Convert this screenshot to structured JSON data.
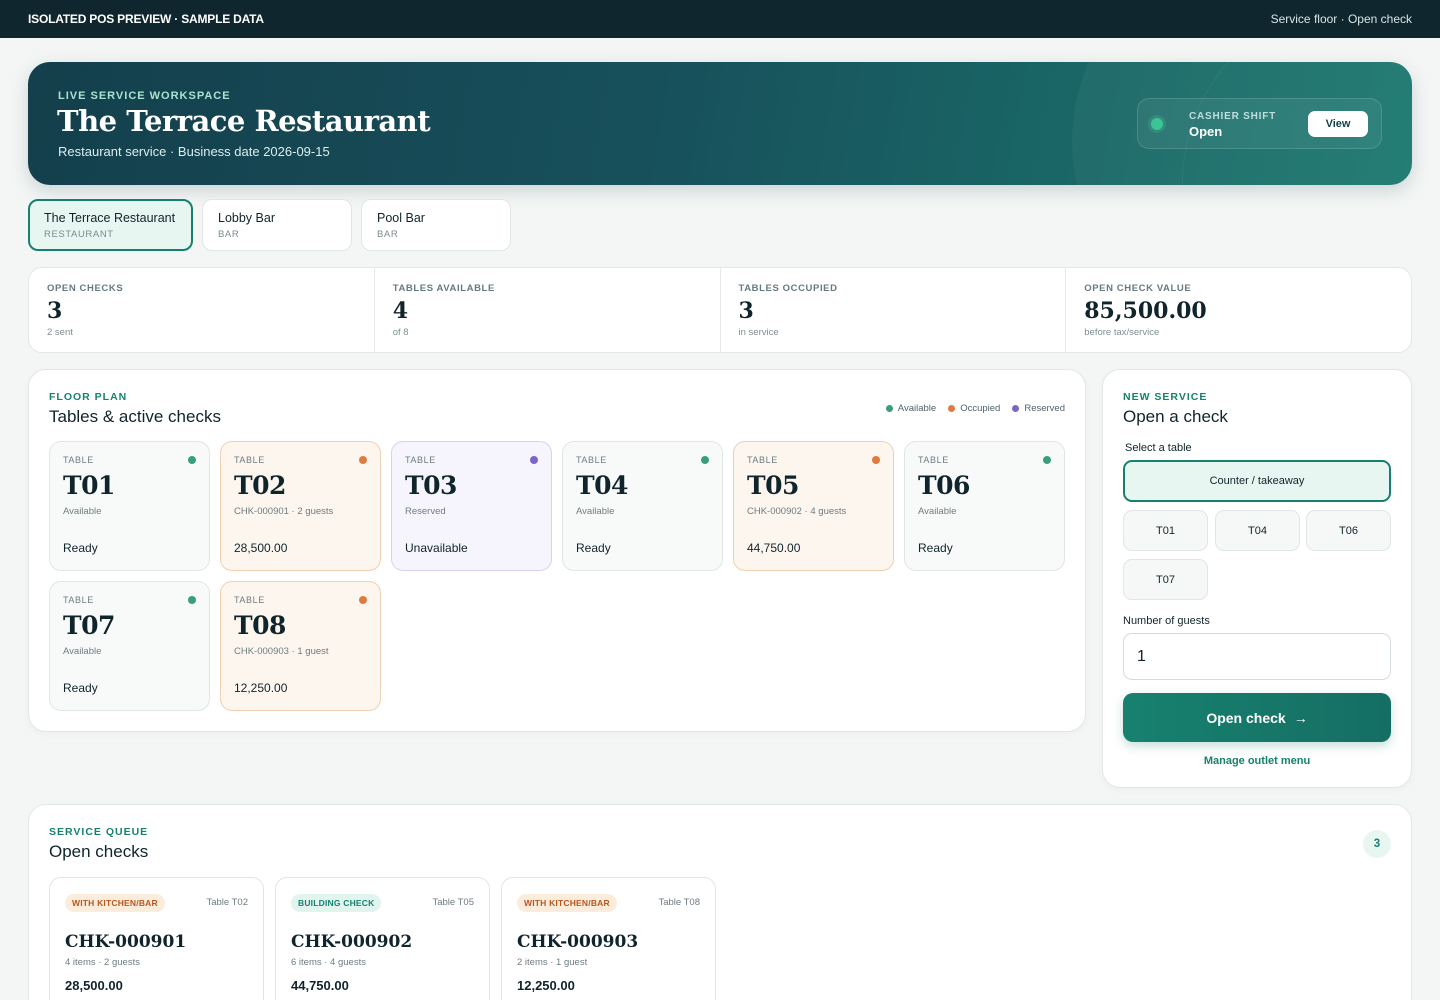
{
  "topbar": {
    "brand": "ISOLATED POS PREVIEW · SAMPLE DATA",
    "context": "Service floor · Open check"
  },
  "hero": {
    "eyebrow": "LIVE SERVICE WORKSPACE",
    "title": "The Terrace Restaurant",
    "subtitle": "Restaurant service · Business date 2026-09-15",
    "shift_label": "CASHIER SHIFT",
    "shift_status": "Open",
    "view_button": "View"
  },
  "outlets": [
    {
      "name": "The Terrace Restaurant",
      "kind": "RESTAURANT",
      "active": true
    },
    {
      "name": "Lobby Bar",
      "kind": "BAR",
      "active": false
    },
    {
      "name": "Pool Bar",
      "kind": "BAR",
      "active": false
    }
  ],
  "stats": [
    {
      "label": "OPEN CHECKS",
      "value": "3",
      "note": "2 sent"
    },
    {
      "label": "TABLES AVAILABLE",
      "value": "4",
      "note": "of 8"
    },
    {
      "label": "TABLES OCCUPIED",
      "value": "3",
      "note": "in service"
    },
    {
      "label": "OPEN CHECK VALUE",
      "value": "85,500.00",
      "note": "before tax/service"
    }
  ],
  "floor": {
    "eyebrow": "FLOOR PLAN",
    "title": "Tables & active checks",
    "legend": {
      "available": "Available",
      "occupied": "Occupied",
      "reserved": "Reserved"
    },
    "colors": {
      "available": "#3a9e7d",
      "occupied": "#e07b3f",
      "reserved": "#7b65c9"
    },
    "tables": [
      {
        "caption": "TABLE",
        "number": "T01",
        "status": "available",
        "meta": "Available",
        "footer": "Ready"
      },
      {
        "caption": "TABLE",
        "number": "T02",
        "status": "occupied",
        "meta": "CHK-000901 · 2 guests",
        "footer": "28,500.00"
      },
      {
        "caption": "TABLE",
        "number": "T03",
        "status": "reserved",
        "meta": "Reserved",
        "footer": "Unavailable"
      },
      {
        "caption": "TABLE",
        "number": "T04",
        "status": "available",
        "meta": "Available",
        "footer": "Ready"
      },
      {
        "caption": "TABLE",
        "number": "T05",
        "status": "occupied",
        "meta": "CHK-000902 · 4 guests",
        "footer": "44,750.00"
      },
      {
        "caption": "TABLE",
        "number": "T06",
        "status": "available",
        "meta": "Available",
        "footer": "Ready"
      },
      {
        "caption": "TABLE",
        "number": "T07",
        "status": "available",
        "meta": "Available",
        "footer": "Ready"
      },
      {
        "caption": "TABLE",
        "number": "T08",
        "status": "occupied",
        "meta": "CHK-000903 · 1 guest",
        "footer": "12,250.00"
      }
    ]
  },
  "new_service": {
    "eyebrow": "NEW SERVICE",
    "title": "Open a check",
    "select_label": "Select a table",
    "counter_option": "Counter / takeaway",
    "table_options": [
      "T01",
      "T04",
      "T06",
      "T07"
    ],
    "guests_label": "Number of guests",
    "guests_value": "1",
    "open_button": "Open check",
    "open_arrow": "→",
    "manage_link": "Manage outlet menu"
  },
  "queue": {
    "eyebrow": "SERVICE QUEUE",
    "title": "Open checks",
    "count": "3",
    "checks": [
      {
        "badge": "WITH KITCHEN/BAR",
        "badge_type": "kitchen",
        "table": "Table T02",
        "id": "CHK-000901",
        "meta": "4 items · 2 guests",
        "amount": "28,500.00"
      },
      {
        "badge": "BUILDING CHECK",
        "badge_type": "building",
        "table": "Table T05",
        "id": "CHK-000902",
        "meta": "6 items · 4 guests",
        "amount": "44,750.00"
      },
      {
        "badge": "WITH KITCHEN/BAR",
        "badge_type": "kitchen",
        "table": "Table T08",
        "id": "CHK-000903",
        "meta": "2 items · 1 guest",
        "amount": "12,250.00"
      }
    ]
  }
}
